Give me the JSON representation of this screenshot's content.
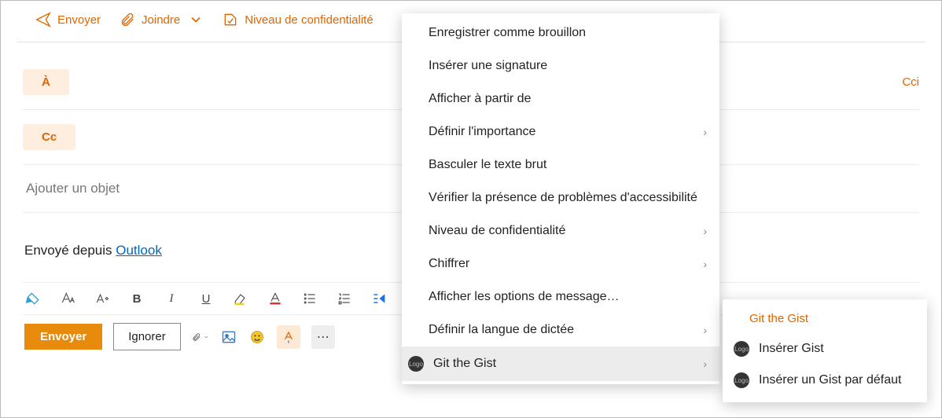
{
  "toolbar": {
    "send": "Envoyer",
    "attach": "Joindre",
    "confidentiality": "Niveau de confidentialité"
  },
  "compose": {
    "to_label": "À",
    "cc_label": "Cc",
    "bcc_label": "Cci",
    "subject_placeholder": "Ajouter un objet",
    "body_prefix": "Envoyé depuis ",
    "body_link": "Outlook"
  },
  "bottom": {
    "send": "Envoyer",
    "discard": "Ignorer"
  },
  "menu": {
    "items": [
      {
        "label": "Enregistrer comme brouillon",
        "sub": false
      },
      {
        "label": "Insérer une signature",
        "sub": false
      },
      {
        "label": "Afficher à partir de",
        "sub": false
      },
      {
        "label": "Définir l'importance",
        "sub": true
      },
      {
        "label": "Basculer le texte brut",
        "sub": false
      },
      {
        "label": "Vérifier la présence de problèmes d'accessibilité",
        "sub": false
      },
      {
        "label": "Niveau de confidentialité",
        "sub": true
      },
      {
        "label": "Chiffrer",
        "sub": true
      },
      {
        "label": "Afficher les options de message…",
        "sub": false
      },
      {
        "label": "Définir la langue de dictée",
        "sub": true
      },
      {
        "label": "Git the Gist",
        "sub": true,
        "icon": true,
        "hl": true
      }
    ]
  },
  "submenu": {
    "title": "Git the Gist",
    "items": [
      {
        "label": "Insérer Gist"
      },
      {
        "label": "Insérer un Gist par défaut"
      }
    ]
  }
}
